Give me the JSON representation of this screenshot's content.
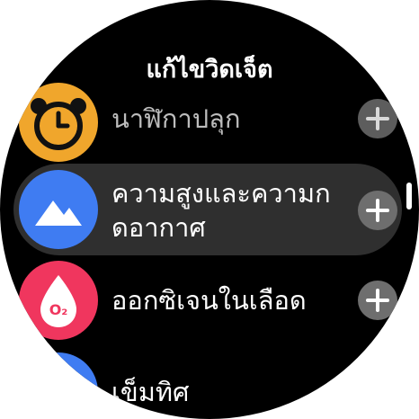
{
  "screen": {
    "title": "แก้ไขวิดเจ็ต"
  },
  "widgets": [
    {
      "label": "นาฬิกาปลุก",
      "icon": "alarm-clock-icon",
      "color": "#f0a62c",
      "selected": false
    },
    {
      "label_line1": "ความสูงและความก",
      "label_line2": "ดอากาศ",
      "icon": "mountain-icon",
      "color": "#3f7cf2",
      "selected": true
    },
    {
      "label": "ออกซิเจนในเลือด",
      "icon": "blood-oxygen-icon",
      "icon_text": "O₂",
      "color": "#f0365e",
      "selected": false
    },
    {
      "label": "เข็มทิศ",
      "icon": "compass-icon",
      "color": "#3f7cf2",
      "selected": false
    }
  ],
  "colors": {
    "background": "#000000",
    "selected_row": "#2f2f2f",
    "add_button": "#6e6e6e"
  }
}
